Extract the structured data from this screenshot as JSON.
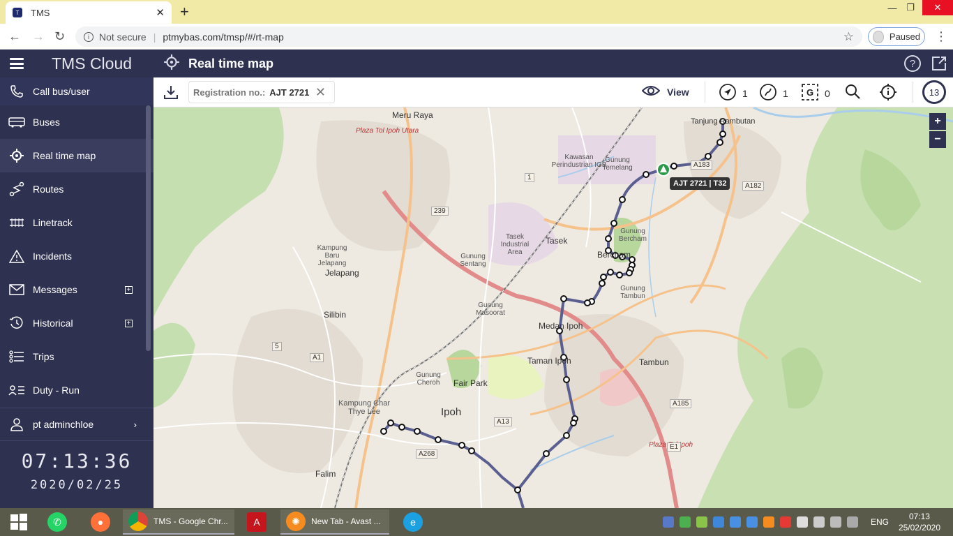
{
  "browser": {
    "tab_title": "TMS",
    "url_security": "Not secure",
    "url": "ptmybas.com/tmsp/#/rt-map",
    "profile_label": "Paused"
  },
  "app": {
    "brand": "TMS Cloud",
    "page_title": "Real time map"
  },
  "sidebar": {
    "items": [
      {
        "label": "Call bus/user",
        "icon": "phone-icon"
      },
      {
        "label": "Buses",
        "icon": "bus-icon"
      },
      {
        "label": "Real time map",
        "icon": "crosshair-icon"
      },
      {
        "label": "Routes",
        "icon": "route-icon"
      },
      {
        "label": "Linetrack",
        "icon": "linetrack-icon"
      },
      {
        "label": "Incidents",
        "icon": "warning-icon"
      },
      {
        "label": "Messages",
        "icon": "mail-icon"
      },
      {
        "label": "Historical",
        "icon": "history-icon"
      },
      {
        "label": "Trips",
        "icon": "trips-icon"
      },
      {
        "label": "Duty - Run",
        "icon": "duty-icon"
      }
    ],
    "user": "pt adminchloe",
    "clock": "07:13:36",
    "date": "2020/02/25"
  },
  "toolbar": {
    "filter_label": "Registration no.:",
    "filter_value": "AJT 2721",
    "view_label": "View",
    "nav_count": "1",
    "route_count": "1",
    "geofence_count": "0",
    "counter": "13"
  },
  "map": {
    "bus_label": "AJT 2721 | T32",
    "places": [
      "Meru Raya",
      "Tanjung Rambutan",
      "Kawasan Perindustrian IGB",
      "Gunung Temelang",
      "Tasek Industrial Area",
      "Tasek",
      "Gunung Bercham",
      "Bercham",
      "Gunung Sentang",
      "Kampung Baru Jelapang",
      "Jelapang",
      "Gunung Tambun",
      "Gunung Masoorat",
      "Medan Ipoh",
      "Silibin",
      "Taman Ipoh",
      "Tambun",
      "Gunung Cheroh",
      "Fair Park",
      "Kampung Char Thye Lee",
      "Ipoh",
      "Falim",
      "Plaza Tol Ipoh Utara",
      "Plaza Tol Ipoh"
    ],
    "shields": [
      "A183",
      "A182",
      "1",
      "239",
      "A1",
      "5",
      "A13",
      "A268",
      "A185",
      "E1"
    ],
    "zoom_in": "+",
    "zoom_out": "−"
  },
  "taskbar": {
    "chrome_label": "TMS - Google Chr...",
    "avast_label": "New Tab - Avast ...",
    "lang": "ENG",
    "time": "07:13",
    "date": "25/02/2020"
  }
}
